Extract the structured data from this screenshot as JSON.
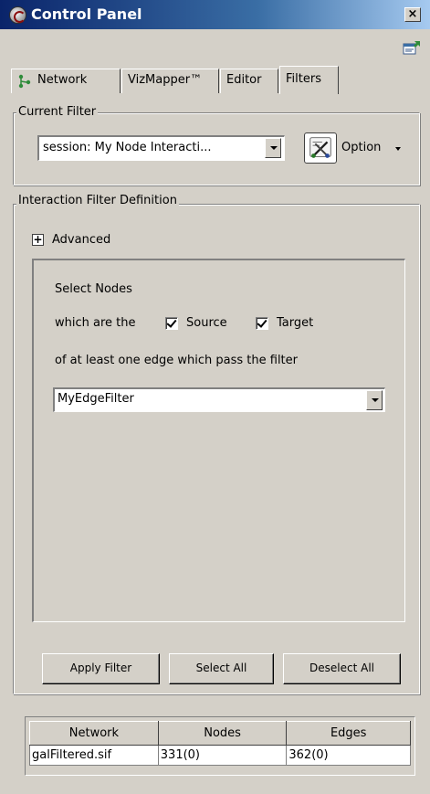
{
  "window": {
    "title": "Control Panel",
    "close_label": "×"
  },
  "tabs": [
    {
      "label": "Network",
      "active": false
    },
    {
      "label": "VizMapper™",
      "active": false
    },
    {
      "label": "Editor",
      "active": false
    },
    {
      "label": "Filters",
      "active": true
    }
  ],
  "current_filter": {
    "legend": "Current Filter",
    "selected": "session: My Node Interacti...",
    "option_label": "Option"
  },
  "interaction_filter": {
    "legend": "Interaction Filter Definition",
    "advanced_toggle": "+",
    "advanced_label": "Advanced",
    "select_nodes": "Select Nodes",
    "which_are_the": "which are the",
    "source_label": "Source",
    "source_checked": true,
    "target_label": "Target",
    "target_checked": true,
    "edge_text": "of at least one edge which pass the filter",
    "edge_filter_selected": "MyEdgeFilter"
  },
  "buttons": {
    "apply_filter": "Apply Filter",
    "select_all": "Select All",
    "deselect_all": "Deselect All"
  },
  "table": {
    "headers": [
      "Network",
      "Nodes",
      "Edges"
    ],
    "rows": [
      [
        "galFiltered.sif",
        "331(0)",
        "362(0)"
      ]
    ]
  },
  "icons": {
    "app": "cytoscape-app-icon",
    "dock": "dock-panel-icon",
    "network_tab": "network-tree-icon",
    "option": "filter-options-icon"
  },
  "colors": {
    "titlebar_start": "#0a246a",
    "titlebar_end": "#a6caf0",
    "panel_bg": "#d4d0c8"
  }
}
